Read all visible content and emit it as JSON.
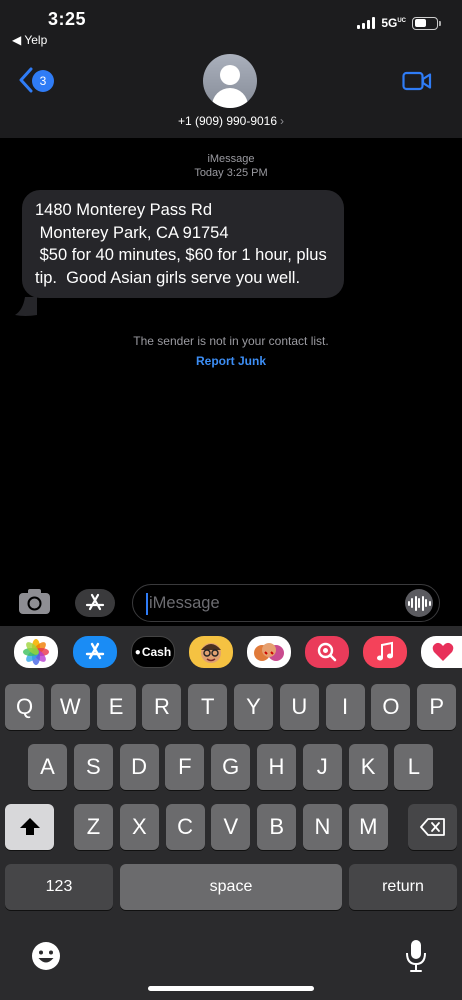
{
  "status": {
    "time": "3:25",
    "back_app": "◀ Yelp",
    "network": "5G",
    "network_sup": "UC"
  },
  "header": {
    "badge_count": "3",
    "contact": "+1 (909) 990-9016",
    "chevron": "›"
  },
  "conversation": {
    "service": "iMessage",
    "timestamp": "Today 3:25 PM",
    "message": "1480 Monterey Pass Rd\n Monterey Park, CA 91754\n $50 for 40 minutes, $60 for 1 hour, plus tip.  Good Asian girls serve you well.",
    "sender_note": "The sender is not in your contact list.",
    "report_label": "Report Junk"
  },
  "input": {
    "placeholder": "iMessage"
  },
  "apps_row": {
    "cash_label": "Cash"
  },
  "keyboard": {
    "row1": [
      "Q",
      "W",
      "E",
      "R",
      "T",
      "Y",
      "U",
      "I",
      "O",
      "P"
    ],
    "row2": [
      "A",
      "S",
      "D",
      "F",
      "G",
      "H",
      "J",
      "K",
      "L"
    ],
    "row3": [
      "Z",
      "X",
      "C",
      "V",
      "B",
      "N",
      "M"
    ],
    "numbers_label": "123",
    "space_label": "space",
    "return_label": "return"
  },
  "colors": {
    "accent": "#2f7cf6",
    "link": "#3d8ef5",
    "bubble": "#26262a",
    "header": "#1c1c1e"
  }
}
